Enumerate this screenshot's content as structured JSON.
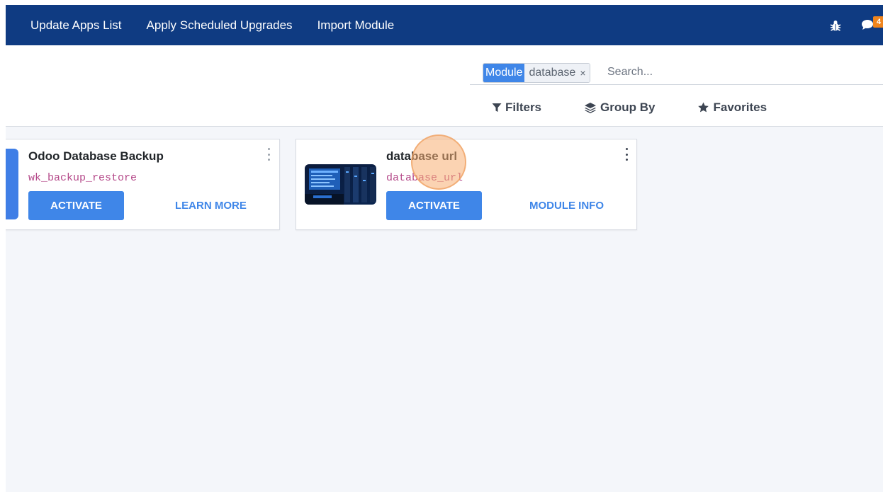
{
  "navbar": {
    "menu": [
      {
        "label": "Update Apps List"
      },
      {
        "label": "Apply Scheduled Upgrades"
      },
      {
        "label": "Import Module"
      }
    ],
    "debug_icon": "bug-icon",
    "chat_icon": "chat-bubble-icon",
    "chat_badge": "4",
    "background": "#0f3b82"
  },
  "search": {
    "facet_label": "Module",
    "facet_value": "database",
    "facet_remove": "×",
    "placeholder": "Search..."
  },
  "filters": {
    "filters_label": "Filters",
    "group_by_label": "Group By",
    "favorites_label": "Favorites"
  },
  "modules": [
    {
      "title": "Odoo Database Backup",
      "technical_name": "wk_backup_restore",
      "activate_label": "ACTIVATE",
      "link_label": "LEARN MORE"
    },
    {
      "title": "database url",
      "technical_name": "database_url",
      "activate_label": "ACTIVATE",
      "link_label": "MODULE INFO"
    }
  ],
  "colors": {
    "primary": "#3f86e8",
    "tech_name": "#b54a8a",
    "badge": "#f0851d"
  }
}
